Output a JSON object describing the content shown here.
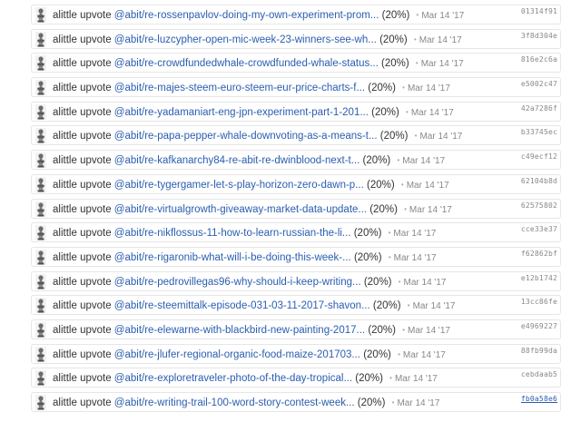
{
  "rows": [
    {
      "voter": "alittle",
      "action": "upvote",
      "author_link": "@abit/re-rossenpavlov-doing-my-own-experiment-prom...",
      "percent": "(20%)",
      "date": "Mar 14 '17",
      "tx": "01314f91"
    },
    {
      "voter": "alittle",
      "action": "upvote",
      "author_link": "@abit/re-luzcypher-open-mic-week-23-winners-see-wh...",
      "percent": "(20%)",
      "date": "Mar 14 '17",
      "tx": "3f8d304e"
    },
    {
      "voter": "alittle",
      "action": "upvote",
      "author_link": "@abit/re-crowdfundedwhale-crowdfunded-whale-status...",
      "percent": "(20%)",
      "date": "Mar 14 '17",
      "tx": "816e2c6a"
    },
    {
      "voter": "alittle",
      "action": "upvote",
      "author_link": "@abit/re-majes-steem-euro-steem-eur-price-charts-f...",
      "percent": "(20%)",
      "date": "Mar 14 '17",
      "tx": "e5002c47"
    },
    {
      "voter": "alittle",
      "action": "upvote",
      "author_link": "@abit/re-yadamaniart-eng-jpn-experiment-part-1-201...",
      "percent": "(20%)",
      "date": "Mar 14 '17",
      "tx": "42a7286f"
    },
    {
      "voter": "alittle",
      "action": "upvote",
      "author_link": "@abit/re-papa-pepper-whale-downvoting-as-a-means-t...",
      "percent": "(20%)",
      "date": "Mar 14 '17",
      "tx": "b33745ec"
    },
    {
      "voter": "alittle",
      "action": "upvote",
      "author_link": "@abit/re-kafkanarchy84-re-abit-re-dwinblood-next-t...",
      "percent": "(20%)",
      "date": "Mar 14 '17",
      "tx": "c49ecf12"
    },
    {
      "voter": "alittle",
      "action": "upvote",
      "author_link": "@abit/re-tygergamer-let-s-play-horizon-zero-dawn-p...",
      "percent": "(20%)",
      "date": "Mar 14 '17",
      "tx": "62104b8d"
    },
    {
      "voter": "alittle",
      "action": "upvote",
      "author_link": "@abit/re-virtualgrowth-giveaway-market-data-update...",
      "percent": "(20%)",
      "date": "Mar 14 '17",
      "tx": "62575802"
    },
    {
      "voter": "alittle",
      "action": "upvote",
      "author_link": "@abit/re-nikflossus-11-how-to-learn-russian-the-li...",
      "percent": "(20%)",
      "date": "Mar 14 '17",
      "tx": "cce33e37"
    },
    {
      "voter": "alittle",
      "action": "upvote",
      "author_link": "@abit/re-rigaronib-what-will-i-be-doing-this-week-...",
      "percent": "(20%)",
      "date": "Mar 14 '17",
      "tx": "f62862bf"
    },
    {
      "voter": "alittle",
      "action": "upvote",
      "author_link": "@abit/re-pedrovillegas96-why-should-i-keep-writing...",
      "percent": "(20%)",
      "date": "Mar 14 '17",
      "tx": "e12b1742"
    },
    {
      "voter": "alittle",
      "action": "upvote",
      "author_link": "@abit/re-steemittalk-episode-031-03-11-2017-shavon...",
      "percent": "(20%)",
      "date": "Mar 14 '17",
      "tx": "13cc86fe"
    },
    {
      "voter": "alittle",
      "action": "upvote",
      "author_link": "@abit/re-elewarne-with-blackbird-new-painting-2017...",
      "percent": "(20%)",
      "date": "Mar 14 '17",
      "tx": "e4969227"
    },
    {
      "voter": "alittle",
      "action": "upvote",
      "author_link": "@abit/re-jlufer-regional-organic-food-maize-201703...",
      "percent": "(20%)",
      "date": "Mar 14 '17",
      "tx": "88fb99da"
    },
    {
      "voter": "alittle",
      "action": "upvote",
      "author_link": "@abit/re-exploretraveler-photo-of-the-day-tropical...",
      "percent": "(20%)",
      "date": "Mar 14 '17",
      "tx": "cebdaab5"
    },
    {
      "voter": "alittle",
      "action": "upvote",
      "author_link": "@abit/re-writing-trail-100-word-story-contest-week...",
      "percent": "(20%)",
      "date": "Mar 14 '17",
      "tx": "fb0a58e6",
      "tx_active": true
    }
  ],
  "colors": {
    "link": "#2a5db0",
    "text": "#333333",
    "muted": "#888888",
    "border": "#e6e6e6"
  },
  "icons": {
    "avatar": "bust-figure-icon"
  }
}
